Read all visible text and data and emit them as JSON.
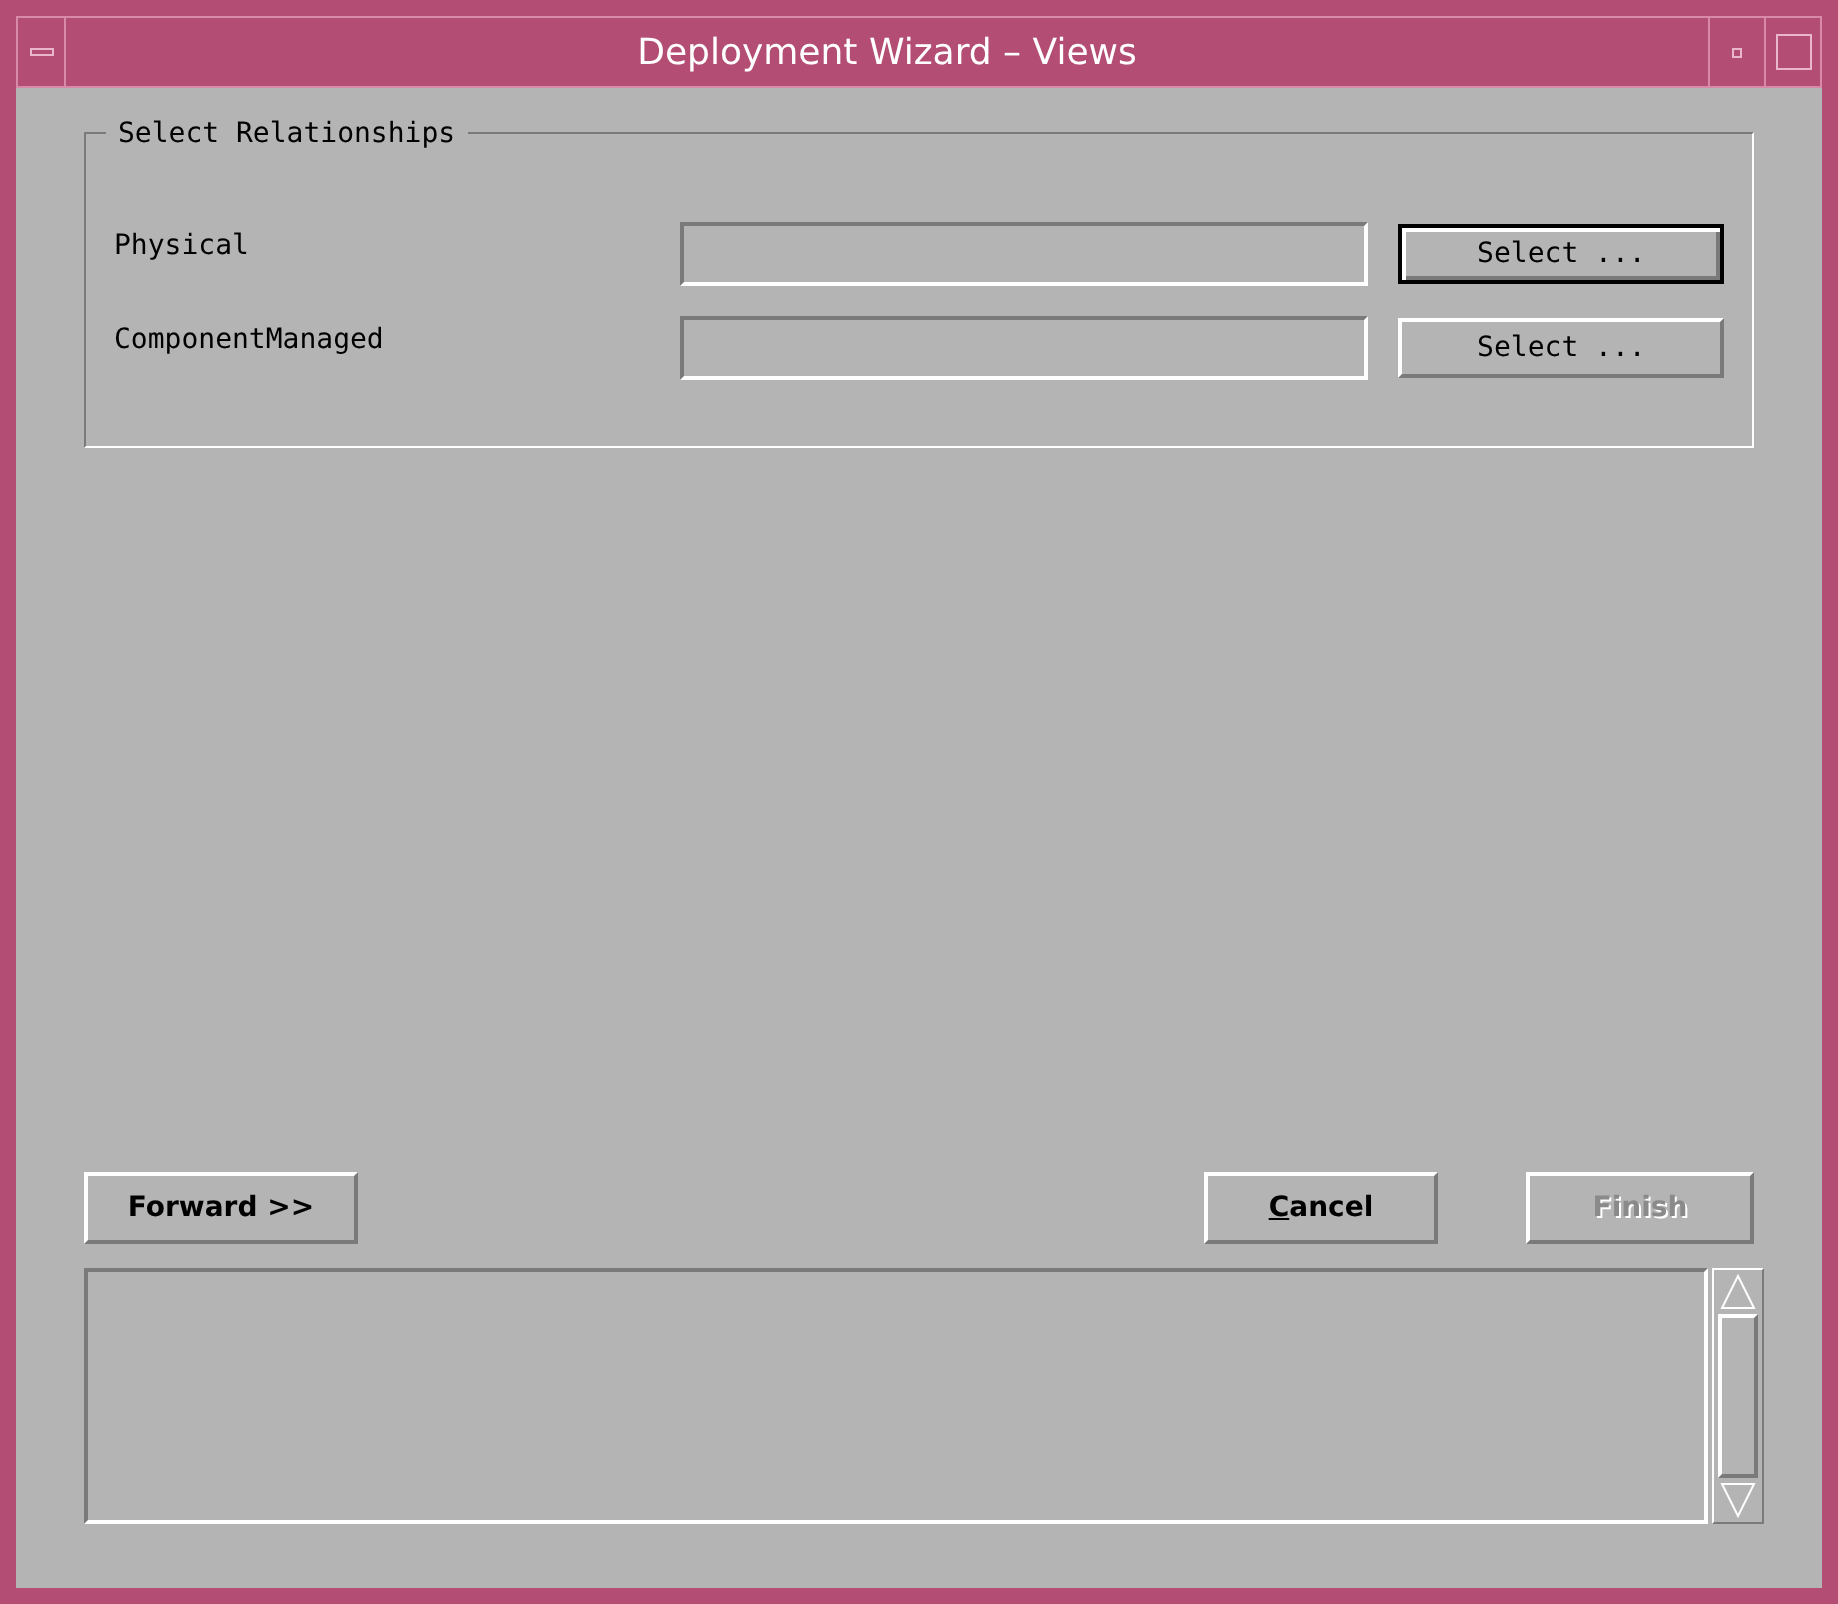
{
  "window": {
    "title": "Deployment Wizard – Views"
  },
  "group": {
    "title": "Select Relationships",
    "rows": [
      {
        "label": "Physical",
        "value": "",
        "button": "Select ...",
        "focused": true
      },
      {
        "label": "ComponentManaged",
        "value": "",
        "button": "Select ...",
        "focused": false
      }
    ]
  },
  "buttons": [
    {
      "label": "Forward >>",
      "mnemonic": false,
      "disabled": false
    },
    {
      "label": "Cancel",
      "mnemonic": true,
      "disabled": false
    },
    {
      "label": "Finish",
      "mnemonic": false,
      "disabled": true
    }
  ]
}
